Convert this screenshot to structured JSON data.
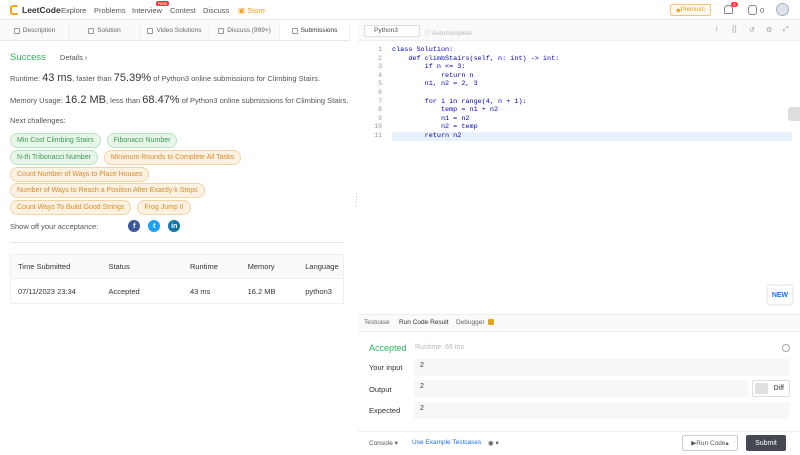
{
  "nav": {
    "logo": "LeetCode",
    "items": [
      "Explore",
      "Problems",
      "Interview",
      "Contest",
      "Discuss"
    ],
    "new_badge": "New",
    "store": "Store",
    "premium": "Premium",
    "notif_count": "3",
    "coins": "0"
  },
  "tabs": [
    "Description",
    "Solution",
    "Video Solutions",
    "Discuss (999+)",
    "Submissions"
  ],
  "result": {
    "status": "Success",
    "details": "Details",
    "runtime_label": "Runtime:",
    "runtime_value": "43 ms",
    "runtime_faster": ", faster than",
    "runtime_percent": "75.39%",
    "runtime_tail": "of Python3 online submissions for Climbing Stairs.",
    "memory_label": "Memory Usage:",
    "memory_value": "16.2 MB",
    "memory_less": ", less than",
    "memory_percent": "68.47%",
    "memory_tail": "of Python3 online submissions for Climbing Stairs.",
    "next_label": "Next challenges:",
    "share_label": "Show off your acceptance:"
  },
  "challenges": [
    [
      {
        "label": "Min Cost Climbing Stairs",
        "level": "easy"
      },
      {
        "label": "Fibonacci Number",
        "level": "easy"
      }
    ],
    [
      {
        "label": "N-th Tribonacci Number",
        "level": "easy"
      },
      {
        "label": "Minimum Rounds to Complete All Tasks",
        "level": "medium"
      }
    ],
    [
      {
        "label": "Count Number of Ways to Place Houses",
        "level": "medium"
      }
    ],
    [
      {
        "label": "Number of Ways to Reach a Position After Exactly k Steps",
        "level": "medium"
      }
    ],
    [
      {
        "label": "Count Ways To Build Good Strings",
        "level": "medium"
      },
      {
        "label": "Frog Jump II",
        "level": "medium"
      }
    ]
  ],
  "submissions": {
    "headers": [
      "Time Submitted",
      "Status",
      "Runtime",
      "Memory",
      "Language"
    ],
    "rows": [
      [
        "07/11/2023 23:34",
        "Accepted",
        "43 ms",
        "16.2 MB",
        "python3"
      ]
    ]
  },
  "editor": {
    "language": "Python3",
    "autocomplete": "Autocomplete",
    "line_numbers": [
      "1",
      "2",
      "3",
      "4",
      "5",
      "6",
      "7",
      "8",
      "9",
      "10",
      "11"
    ],
    "code": [
      "class Solution:",
      "    def climbStairs(self, n: int) -> int:",
      "        if n <= 3:",
      "            return n",
      "        n1, n2 = 2, 3",
      "",
      "        for i in range(4, n + 1):",
      "            temp = n1 + n2",
      "            n1 = n2",
      "            n2 = temp",
      "        return n2"
    ],
    "new_label": "NEW"
  },
  "console": {
    "tabs": [
      "Testcase",
      "Run Code Result",
      "Debugger"
    ],
    "status": "Accepted",
    "runtime": "Runtime: 69 ms",
    "input_label": "Your input",
    "input_value": "2",
    "output_label": "Output",
    "output_value": "2",
    "diff_label": "Diff",
    "expected_label": "Expected",
    "expected_value": "2"
  },
  "bottom": {
    "console": "Console",
    "use_example": "Use Example Testcases",
    "run_code": "Run Code",
    "submit": "Submit"
  },
  "colors": {
    "success": "#2db55d",
    "brand": "#f89f1b",
    "link": "#1a73e8"
  }
}
